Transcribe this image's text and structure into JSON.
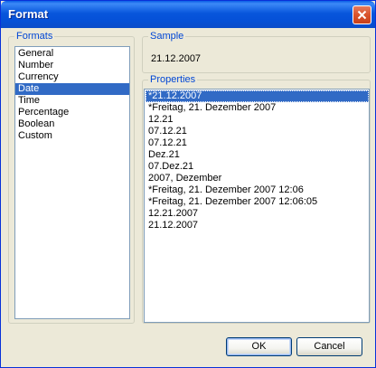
{
  "window": {
    "title": "Format"
  },
  "formats": {
    "legend": "Formats",
    "items": [
      "General",
      "Number",
      "Currency",
      "Date",
      "Time",
      "Percentage",
      "Boolean",
      "Custom"
    ],
    "selected_index": 3
  },
  "sample": {
    "legend": "Sample",
    "value": "21.12.2007"
  },
  "properties": {
    "legend": "Properties",
    "items": [
      "*21.12.2007",
      "*Freitag, 21. Dezember 2007",
      "12.21",
      "07.12.21",
      "07.12.21",
      "Dez.21",
      "07.Dez.21",
      "2007, Dezember",
      "*Freitag, 21. Dezember 2007 12:06",
      "*Freitag, 21. Dezember 2007 12:06:05",
      "12.21.2007",
      "21.12.2007"
    ],
    "selected_index": 0
  },
  "buttons": {
    "ok_label": "OK",
    "cancel_label": "Cancel"
  },
  "colors": {
    "selection": "#316ac5",
    "legend_text": "#0046d5",
    "title_bar": "#0856dc"
  }
}
